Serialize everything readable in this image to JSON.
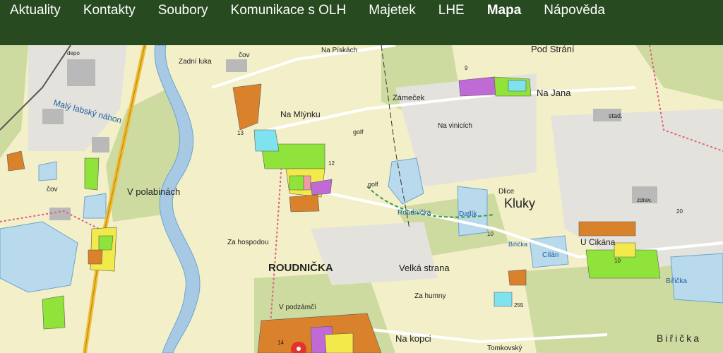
{
  "nav": {
    "items": [
      {
        "label": "Aktuality",
        "active": false
      },
      {
        "label": "Kontakty",
        "active": false
      },
      {
        "label": "Soubory",
        "active": false
      },
      {
        "label": "Komunikace s OLH",
        "active": false
      },
      {
        "label": "Majetek",
        "active": false
      },
      {
        "label": "LHE",
        "active": false
      },
      {
        "label": "Mapa",
        "active": true
      },
      {
        "label": "Nápověda",
        "active": false
      }
    ]
  },
  "map": {
    "labels": {
      "zadni_luka": "Zadní luka",
      "cov_top": "čov",
      "na_piskach": "Na Pískách",
      "pod_strani": "Pod Strání",
      "depo": "depo",
      "maly_labsky_nahon": "Malý labský náhon",
      "na_mlynku": "Na Mlýnku",
      "zamecek": "Zámeček",
      "na_jana": "Na Jana",
      "stad": "stad.",
      "na_vinicich": "Na vinicích",
      "golf1": "golf",
      "golf2": "golf",
      "cov_left": "čov",
      "v_polabinach": "V polabinách",
      "roudnicka_lake": "Roudnička",
      "datlik": "Datlík",
      "dlice": "Dlice",
      "kluky": "Kluky",
      "zdrav": "zdrav.",
      "za_hospodou": "Za hospodou",
      "biricka1": "Biřička",
      "cilan": "Cílán",
      "u_cikana": "U Cikána",
      "roudnicka_village": "ROUDNIČKA",
      "velka_strana": "Velká strana",
      "za_humny": "Za humny",
      "v_podzamci": "V podzámčí",
      "biricka2": "Biřička",
      "biricka3": "Biřička",
      "na_kopci": "Na kopci",
      "tomkovsky": "Tomkovský",
      "n255": "255",
      "n13": "13",
      "n12": "12",
      "n10a": "10",
      "n10b": "10",
      "n20": "20",
      "n9": "9",
      "n14": "14"
    },
    "colors": {
      "header": "#274a21",
      "land": "#f3efc8",
      "forest": "#cddba0",
      "water": "#b9d9ec",
      "river": "#a7c9e4",
      "road_major": "#f0bb32",
      "urban": "#d4d4d4",
      "parcel_orange": "#d9822b",
      "parcel_green": "#8fe33a",
      "parcel_yellow": "#f2ea4a",
      "parcel_cyan": "#7fe3ef",
      "parcel_purple": "#c06ad6",
      "parcel_pink": "#f09aa3",
      "marker": "#e5322d",
      "boundary": "#e0607f",
      "trail": "#3c9a4f"
    }
  }
}
